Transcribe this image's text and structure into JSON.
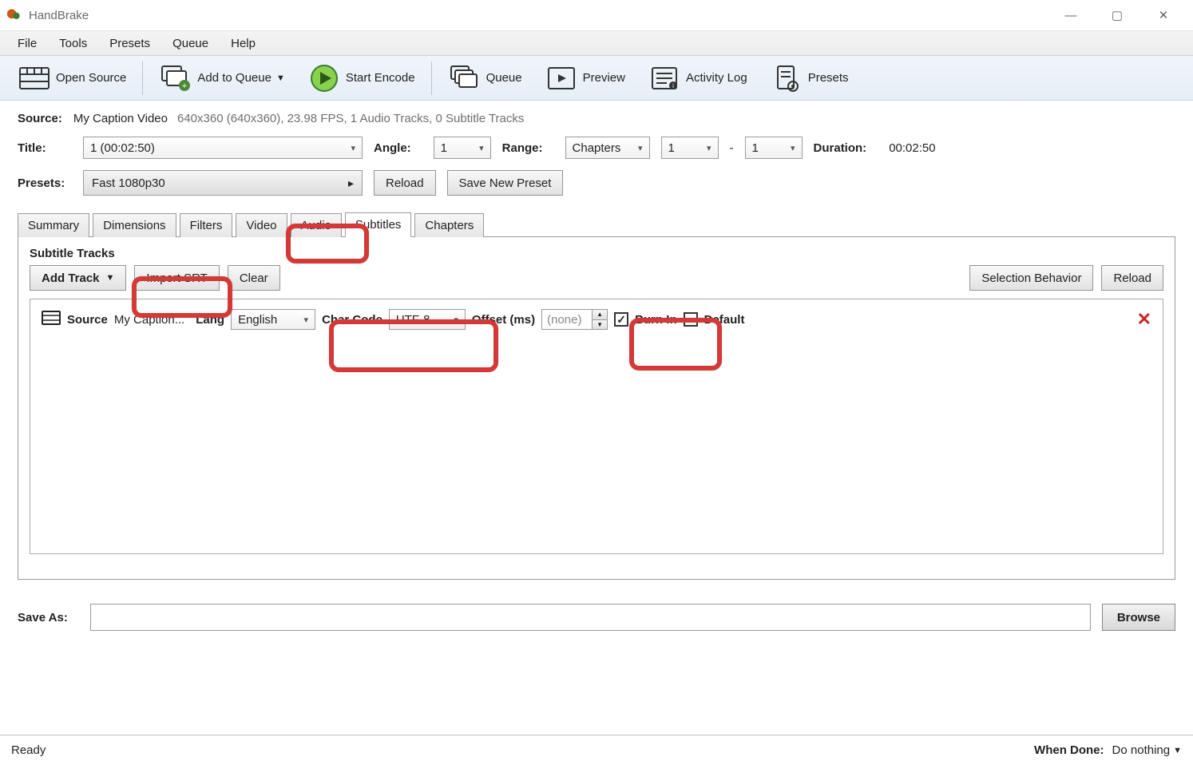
{
  "app": {
    "title": "HandBrake"
  },
  "win_controls": {
    "min": "—",
    "max": "▢",
    "close": "✕"
  },
  "menu": {
    "file": "File",
    "tools": "Tools",
    "presets": "Presets",
    "queue": "Queue",
    "help": "Help"
  },
  "toolbar": {
    "open_source": "Open Source",
    "add_queue": "Add to Queue",
    "start_encode": "Start Encode",
    "queue": "Queue",
    "preview": "Preview",
    "activity_log": "Activity Log",
    "presets": "Presets"
  },
  "source": {
    "label": "Source:",
    "name": "My Caption Video",
    "details": "640x360 (640x360), 23.98 FPS, 1 Audio Tracks, 0 Subtitle Tracks"
  },
  "title_row": {
    "title_label": "Title:",
    "title_value": "1 (00:02:50)",
    "angle_label": "Angle:",
    "angle_value": "1",
    "range_label": "Range:",
    "range_type": "Chapters",
    "range_from": "1",
    "range_sep": "-",
    "range_to": "1",
    "duration_label": "Duration:",
    "duration_value": "00:02:50"
  },
  "presets_row": {
    "label": "Presets:",
    "value": "Fast 1080p30",
    "reload": "Reload",
    "save_new": "Save New Preset"
  },
  "tabs": {
    "summary": "Summary",
    "dimensions": "Dimensions",
    "filters": "Filters",
    "video": "Video",
    "audio": "Audio",
    "subtitles": "Subtitles",
    "chapters": "Chapters"
  },
  "subtitles": {
    "header": "Subtitle Tracks",
    "add_track": "Add Track",
    "import_srt": "Import SRT",
    "clear": "Clear",
    "selection_behavior": "Selection Behavior",
    "reload": "Reload",
    "track": {
      "source_label": "Source",
      "source_value": "My Caption...",
      "lang_label": "Lang",
      "lang_value": "English",
      "charcode_label": "Char Code",
      "charcode_value": "UTF-8",
      "offset_label": "Offset (ms)",
      "offset_placeholder": "(none)",
      "burnin_label": "Burn In",
      "default_label": "Default"
    }
  },
  "save": {
    "label": "Save As:",
    "browse": "Browse"
  },
  "status": {
    "ready": "Ready",
    "when_done_label": "When Done:",
    "when_done_value": "Do nothing"
  }
}
